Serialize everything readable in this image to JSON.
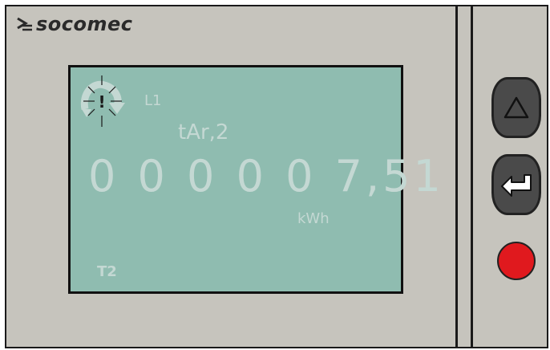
{
  "brand": {
    "name": "socomec"
  },
  "display": {
    "phase": "L1",
    "register": "tAr,2",
    "reading": "0 0 0 0 0 7,51",
    "unit": "kWh",
    "tariff_indicator": "T2",
    "alarm_icon": "alarm-warning-icon"
  },
  "buttons": {
    "up": {
      "icon": "up-arrow-icon"
    },
    "enter": {
      "icon": "enter-icon"
    },
    "red": {
      "icon": "red-button"
    }
  },
  "colors": {
    "housing": "#c6c4bd",
    "lcd": "#8fbcb0",
    "lcd_segment": "#c4d8d3",
    "button": "#4a4a4a",
    "red_button": "#e0191e"
  }
}
